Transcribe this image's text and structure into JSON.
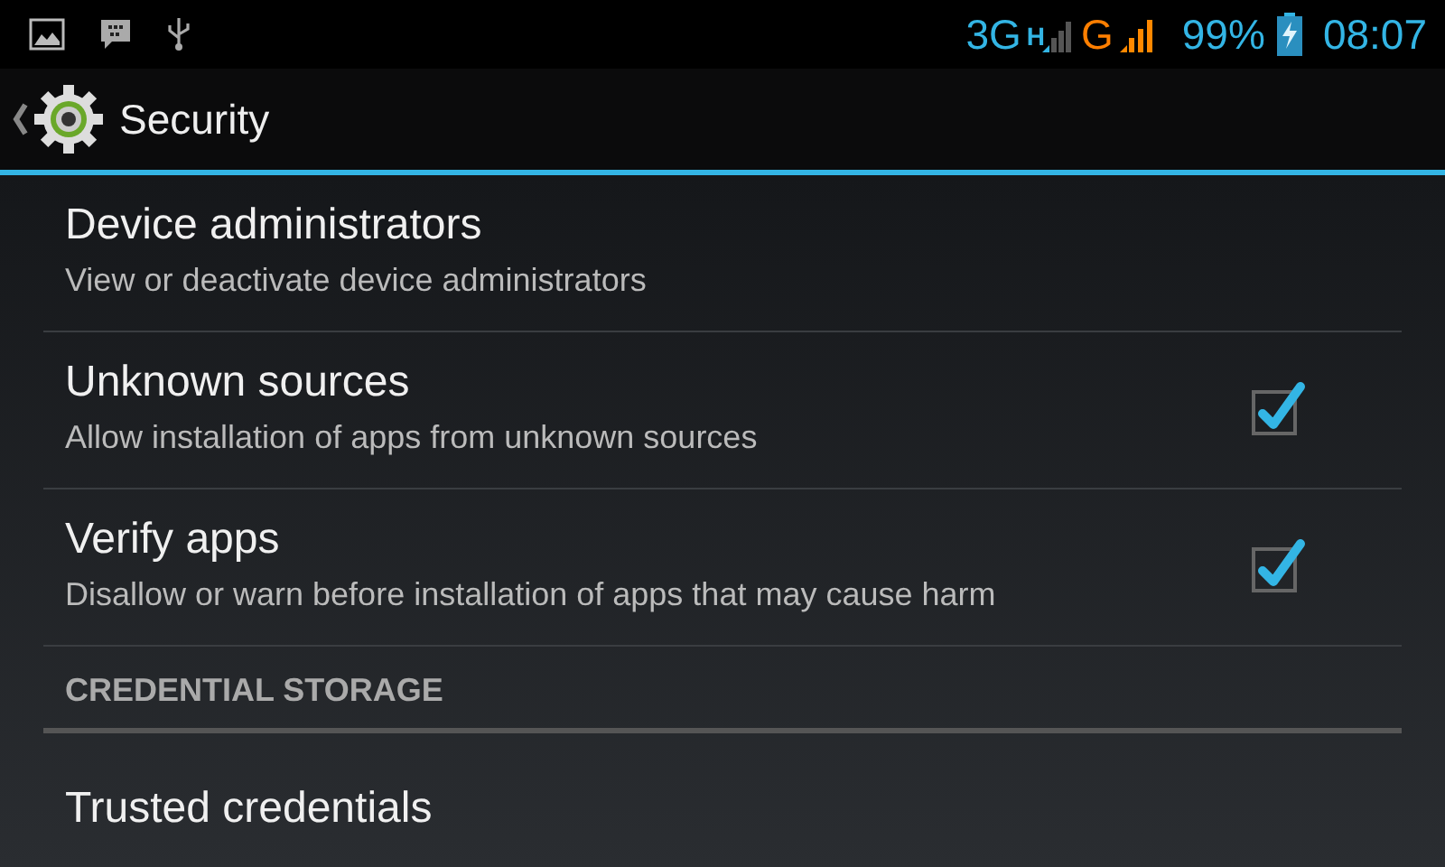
{
  "status_bar": {
    "network_1": "3G",
    "network_1_badge": "H",
    "network_2": "G",
    "battery": "99%",
    "time": "08:07"
  },
  "action_bar": {
    "title": "Security"
  },
  "settings": [
    {
      "kind": "item",
      "title": "Device administrators",
      "summary": "View or deactivate device administrators"
    },
    {
      "kind": "item",
      "title": "Unknown sources",
      "summary": "Allow installation of apps from unknown sources",
      "checked": true
    },
    {
      "kind": "item",
      "title": "Verify apps",
      "summary": "Disallow or warn before installation of apps that may cause harm",
      "checked": true
    },
    {
      "kind": "header",
      "title": "CREDENTIAL STORAGE"
    },
    {
      "kind": "item",
      "title": "Trusted credentials"
    }
  ]
}
